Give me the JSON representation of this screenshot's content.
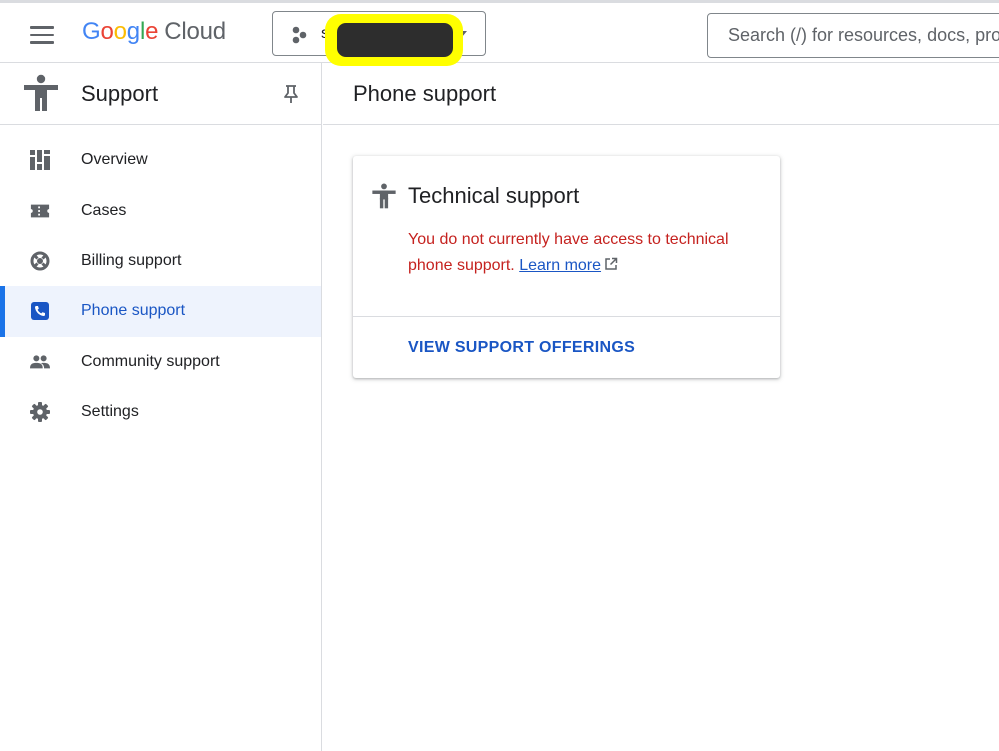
{
  "colors": {
    "accent": "#1a73e8",
    "link": "#1a56c4",
    "error": "#c5221f",
    "active_nav_bg": "#eef3fd",
    "redaction_highlight": "#ffff00",
    "redaction_box": "#2d2d2d"
  },
  "header": {
    "menu_icon": "hamburger-menu-icon",
    "logo": {
      "letters": [
        "G",
        "o",
        "o",
        "g",
        "l",
        "e"
      ],
      "product": "Cloud"
    },
    "project_picker": {
      "icon": "project-dots-icon",
      "value": "s",
      "caret_icon": "caret-down-icon"
    },
    "search": {
      "placeholder": "Search (/) for resources, docs, products, and more"
    }
  },
  "sidebar": {
    "icon": "support-person-icon",
    "title": "Support",
    "pin_icon": "pin-icon",
    "items": [
      {
        "label": "Overview",
        "icon": "dashboard-icon",
        "active": false
      },
      {
        "label": "Cases",
        "icon": "ticket-icon",
        "active": false
      },
      {
        "label": "Billing support",
        "icon": "lifebuoy-icon",
        "active": false
      },
      {
        "label": "Phone support",
        "icon": "phone-icon",
        "active": true
      },
      {
        "label": "Community support",
        "icon": "people-icon",
        "active": false
      },
      {
        "label": "Settings",
        "icon": "gear-icon",
        "active": false
      }
    ]
  },
  "main": {
    "title": "Phone support",
    "card": {
      "icon": "support-person-icon",
      "title": "Technical support",
      "message": "You do not currently have access to technical phone support.",
      "link_text": "Learn more",
      "link_icon": "external-link-icon",
      "action_label": "VIEW SUPPORT OFFERINGS"
    }
  }
}
